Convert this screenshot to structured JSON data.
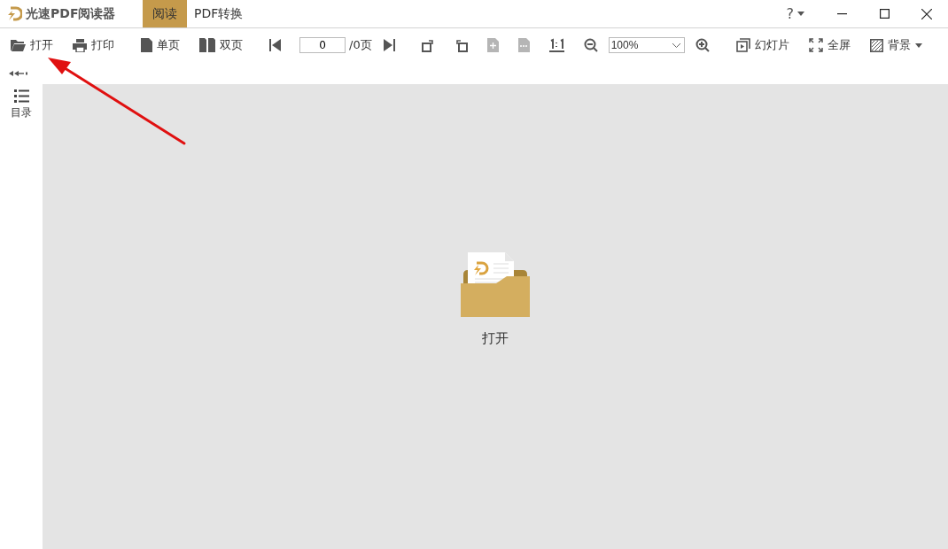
{
  "app_title": "光速PDF阅读器",
  "tabs": [
    {
      "label": "阅读",
      "selected": true
    },
    {
      "label": "PDF转换",
      "selected": false
    }
  ],
  "help": "?",
  "toolbar": [
    {
      "kind": "button",
      "label": "打开",
      "disabled": false
    },
    {
      "kind": "button",
      "label": "打印",
      "disabled": false
    },
    {
      "kind": "button",
      "label": "单页",
      "disabled": false
    },
    {
      "kind": "button",
      "label": "双页",
      "disabled": false
    },
    {
      "kind": "icon",
      "disabled": false
    },
    {
      "kind": "page-field",
      "value": "0"
    },
    {
      "kind": "text",
      "label": "/0页"
    },
    {
      "kind": "icon",
      "disabled": false
    },
    {
      "kind": "icon",
      "disabled": false
    },
    {
      "kind": "icon",
      "disabled": false
    },
    {
      "kind": "icon",
      "disabled": true
    },
    {
      "kind": "icon",
      "disabled": true
    },
    {
      "kind": "icon",
      "disabled": false
    },
    {
      "kind": "icon",
      "disabled": false
    },
    {
      "kind": "select",
      "value": "100%"
    },
    {
      "kind": "icon",
      "disabled": false
    },
    {
      "kind": "button",
      "label": "幻灯片",
      "disabled": false
    },
    {
      "kind": "button",
      "label": "全屏",
      "disabled": false
    },
    {
      "kind": "dropdown",
      "label": "背景",
      "disabled": false
    }
  ],
  "sidebar": {
    "items": [
      {
        "label": "目录"
      }
    ]
  },
  "open_prompt": {
    "label": "打开"
  }
}
